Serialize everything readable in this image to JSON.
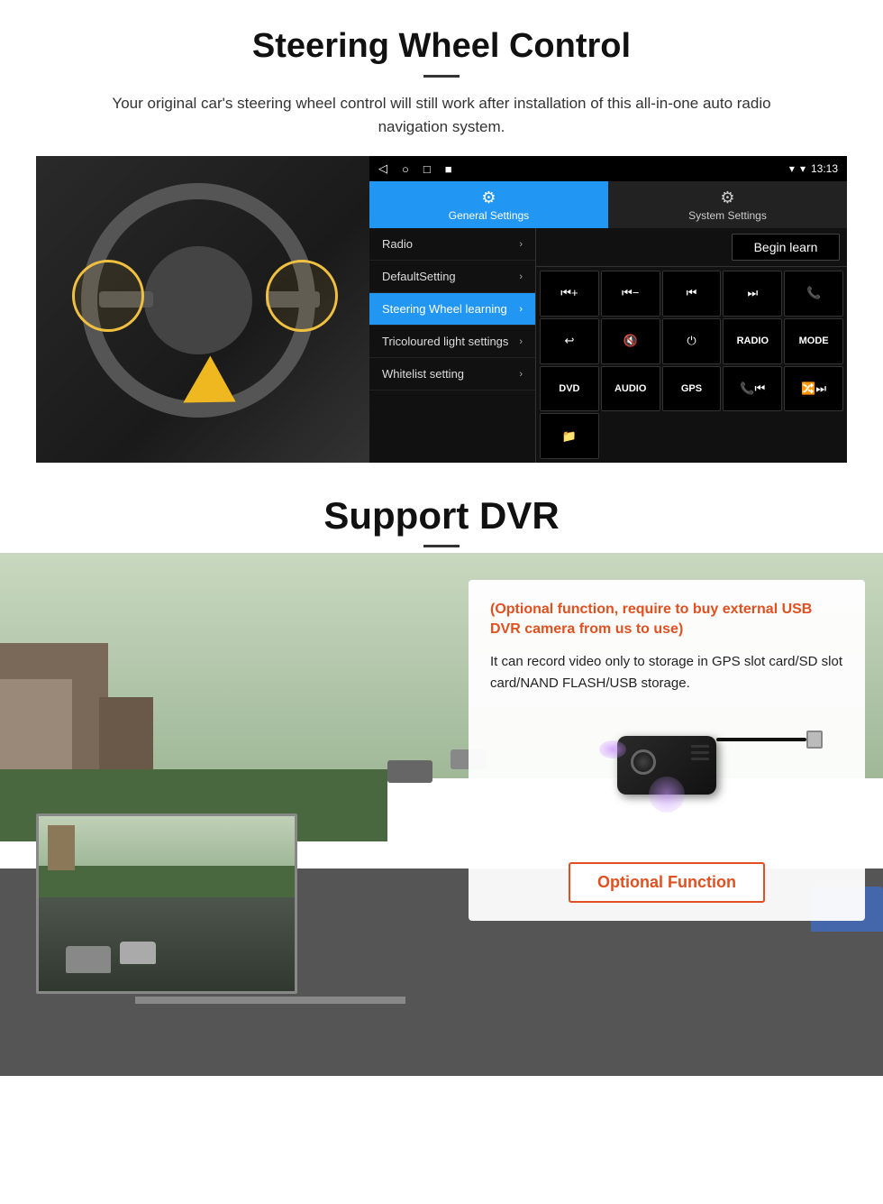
{
  "steering": {
    "title": "Steering Wheel Control",
    "subtitle": "Your original car's steering wheel control will still work after installation of this all-in-one auto radio navigation system.",
    "android": {
      "statusbar": {
        "nav_back": "◁",
        "nav_home": "○",
        "nav_recent": "□",
        "nav_menu": "■",
        "signal": "▾",
        "wifi": "▾",
        "time": "13:13"
      },
      "tab_general": "General Settings",
      "tab_system": "System Settings",
      "tab_general_icon": "⚙",
      "tab_system_icon": "⚙",
      "menu_items": [
        {
          "label": "Radio",
          "active": false
        },
        {
          "label": "DefaultSetting",
          "active": false
        },
        {
          "label": "Steering Wheel learning",
          "active": true
        },
        {
          "label": "Tricoloured light settings",
          "active": false
        },
        {
          "label": "Whitelist setting",
          "active": false
        }
      ],
      "begin_learn": "Begin learn",
      "control_buttons": [
        "⏮+",
        "⏮−",
        "⏮⏮",
        "⏭⏭",
        "☎",
        "↩",
        "🔇×",
        "⏻",
        "RADIO",
        "MODE",
        "DVD",
        "AUDIO",
        "GPS",
        "📞⏮",
        "🔀⏭",
        "📁"
      ]
    }
  },
  "dvr": {
    "title": "Support DVR",
    "optional_text": "(Optional function, require to buy external USB DVR camera from us to use)",
    "desc_text": "It can record video only to storage in GPS slot card/SD slot card/NAND FLASH/USB storage.",
    "optional_function_label": "Optional Function"
  }
}
